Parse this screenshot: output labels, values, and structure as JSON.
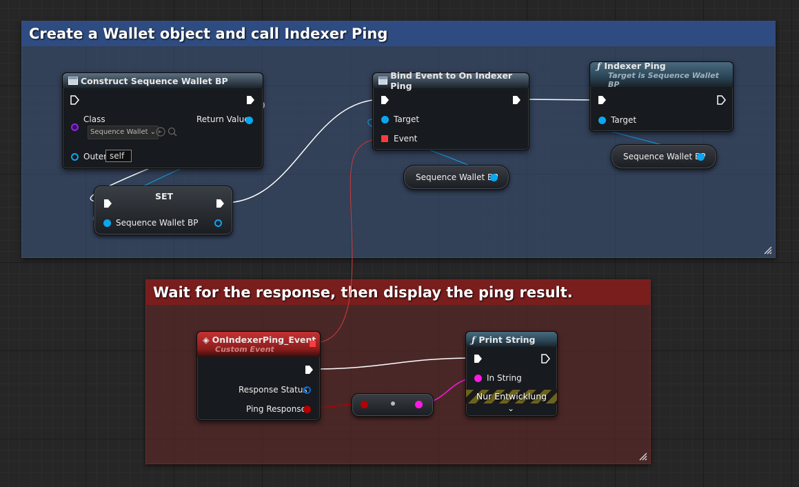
{
  "comments": {
    "top": "Create a Wallet object and call Indexer Ping",
    "bottom": "Wait for the response, then display the ping result."
  },
  "construct_node": {
    "title": "Construct Sequence Wallet BP",
    "class_label": "Class",
    "class_value": "Sequence Wallet",
    "return_label": "Return Value",
    "outer_label": "Outer",
    "outer_value": "self"
  },
  "set_node": {
    "title": "SET",
    "pin_label": "Sequence Wallet BP"
  },
  "bind_node": {
    "title": "Bind Event to On Indexer Ping",
    "target_label": "Target",
    "event_label": "Event"
  },
  "ping_node": {
    "title": "Indexer Ping",
    "subtitle": "Target is Sequence Wallet BP",
    "target_label": "Target"
  },
  "var_getters": {
    "middle": "Sequence Wallet BP",
    "right": "Sequence Wallet BP"
  },
  "event_node": {
    "title": "OnIndexerPing_Event",
    "subtitle": "Custom Event",
    "status_label": "Response Status",
    "response_label": "Ping Response"
  },
  "print_node": {
    "title": "Print String",
    "instring_label": "In String",
    "dev_label": "Nur Entwicklung"
  },
  "colors": {
    "object_pin": "#0aa7f0",
    "class_pin": "#8a2be2",
    "delegate_pin": "#ff3b3b",
    "string_pin": "#ff19e1",
    "struct_pin": "#b30000",
    "exec_wire": "#ffffff"
  }
}
